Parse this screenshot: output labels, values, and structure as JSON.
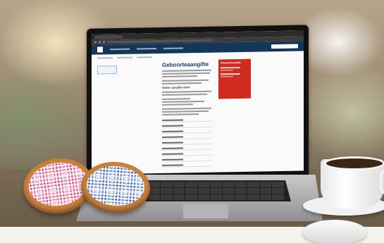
{
  "screen": {
    "page_title": "Geboorteaangifte",
    "sub_heading": "Online aangifte doen",
    "side_panel_title": "Geboorteaangifte"
  },
  "colors": {
    "site_header": "#14365a",
    "side_panel": "#d12a1f",
    "pink_sprinkles": "#f2b8c8",
    "blue_sprinkles": "#c7d2ee"
  }
}
